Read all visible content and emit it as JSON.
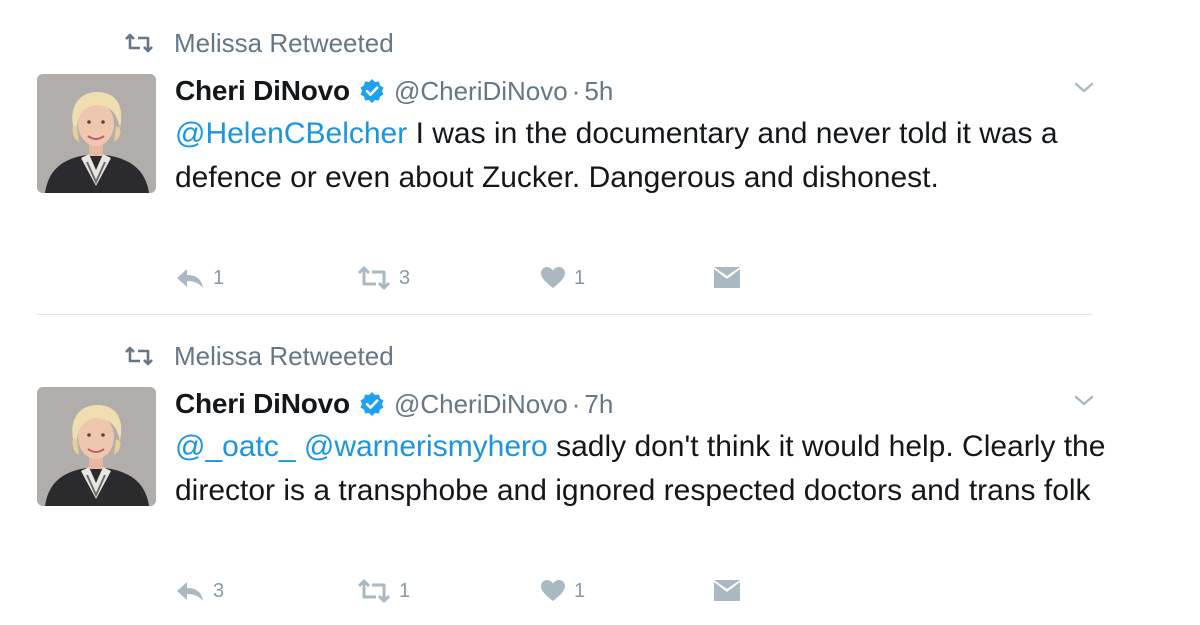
{
  "tweets": [
    {
      "retweeted_by": "Melissa Retweeted",
      "author": {
        "name": "Cheri DiNovo",
        "handle": "@CheriDiNovo",
        "time": "5h"
      },
      "body": {
        "mentions": [
          "@HelenCBelcher"
        ],
        "text": " I was in the documentary and never told it was a defence or even about Zucker.  Dangerous and dishonest."
      },
      "actions": {
        "reply": "1",
        "retweet": "3",
        "like": "1"
      }
    },
    {
      "retweeted_by": "Melissa Retweeted",
      "author": {
        "name": "Cheri DiNovo",
        "handle": "@CheriDiNovo",
        "time": "7h"
      },
      "body": {
        "mentions": [
          "@_oatc_",
          "@warnerismyhero"
        ],
        "text": " sadly don't think it would help. Clearly the director is a transphobe and ignored respected doctors and trans folk"
      },
      "actions": {
        "reply": "3",
        "retweet": "1",
        "like": "1"
      }
    }
  ],
  "separator_dot": "·",
  "icons": [
    "retweet-icon",
    "verified-badge-icon",
    "chevron-down-icon",
    "reply-icon",
    "like-icon",
    "direct-message-icon"
  ],
  "colors": {
    "link": "#1b95e0",
    "verified": "#1da1f2",
    "muted": "#657786",
    "action": "#aab8c2",
    "text": "#14171a"
  }
}
